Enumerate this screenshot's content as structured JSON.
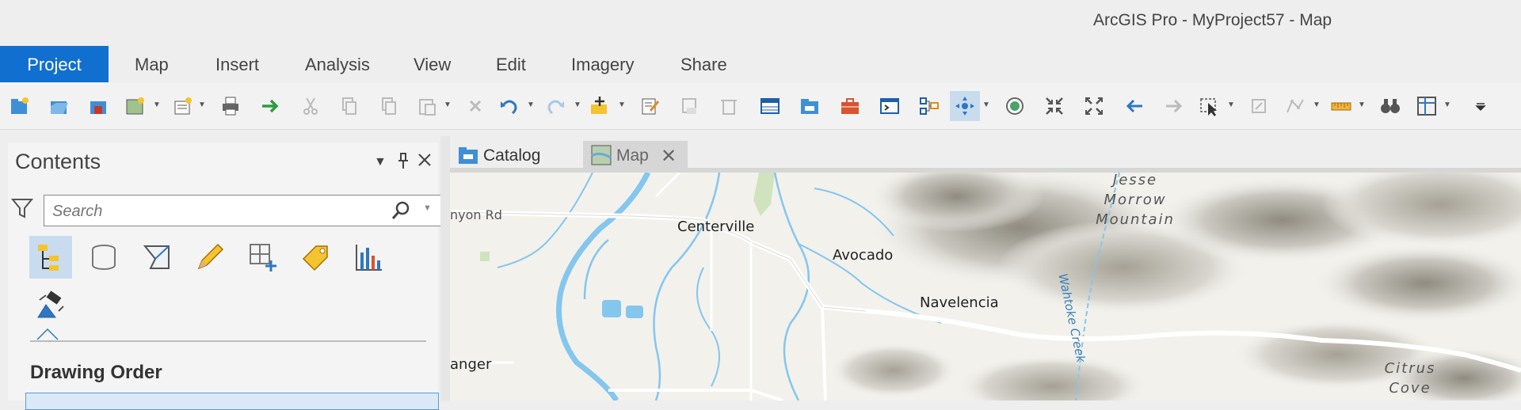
{
  "window": {
    "title": "ArcGIS Pro - MyProject57 - Map"
  },
  "ribbon": {
    "tabs": [
      {
        "label": "Project",
        "active": true
      },
      {
        "label": "Map"
      },
      {
        "label": "Insert"
      },
      {
        "label": "Analysis"
      },
      {
        "label": "View"
      },
      {
        "label": "Edit"
      },
      {
        "label": "Imagery"
      },
      {
        "label": "Share"
      }
    ]
  },
  "toolbar": {
    "icons": [
      "new-project-icon",
      "open-project-icon",
      "save-project-icon",
      "new-map-icon",
      "add-item-icon",
      "print-icon",
      "forward-arrow-icon",
      "cut-icon",
      "copy-icon",
      "copy-path-icon",
      "paste-icon",
      "delete-icon",
      "undo-icon",
      "redo-icon",
      "add-data-icon",
      "edit-icon",
      "clear-selection-icon",
      "delete-features-icon",
      "attribute-table-icon",
      "catalog-icon",
      "toolbox-icon",
      "python-icon",
      "layout-icon",
      "navigate-icon",
      "explore-icon",
      "full-extent-icon",
      "fixed-zoom-icon",
      "previous-extent-icon",
      "next-extent-icon",
      "select-icon",
      "select-by-attributes-icon",
      "clear-icon",
      "measure-icon",
      "locate-icon",
      "view-icon",
      "overflow-icon"
    ]
  },
  "contents": {
    "title": "Contents",
    "search_placeholder": "Search",
    "section_title": "Drawing Order"
  },
  "doc_tabs": [
    {
      "label": "Catalog",
      "active": false
    },
    {
      "label": "Map",
      "active": true
    }
  ],
  "map": {
    "places": {
      "canyon_rd": "nyon Rd",
      "centerville": "Centerville",
      "avocado": "Avocado",
      "navelencia": "Navelencia",
      "sanger": "anger",
      "jesse_1": "Jesse",
      "jesse_2": "Morrow",
      "jesse_3": "Mountain",
      "wahtoke": "Wahtoke Creek",
      "citrus_1": "Citrus",
      "citrus_2": "Cove"
    },
    "colors": {
      "water": "#84c6ee",
      "land": "#f2f1ec",
      "road": "#ffffff",
      "hills": "#c9c7bf"
    }
  }
}
